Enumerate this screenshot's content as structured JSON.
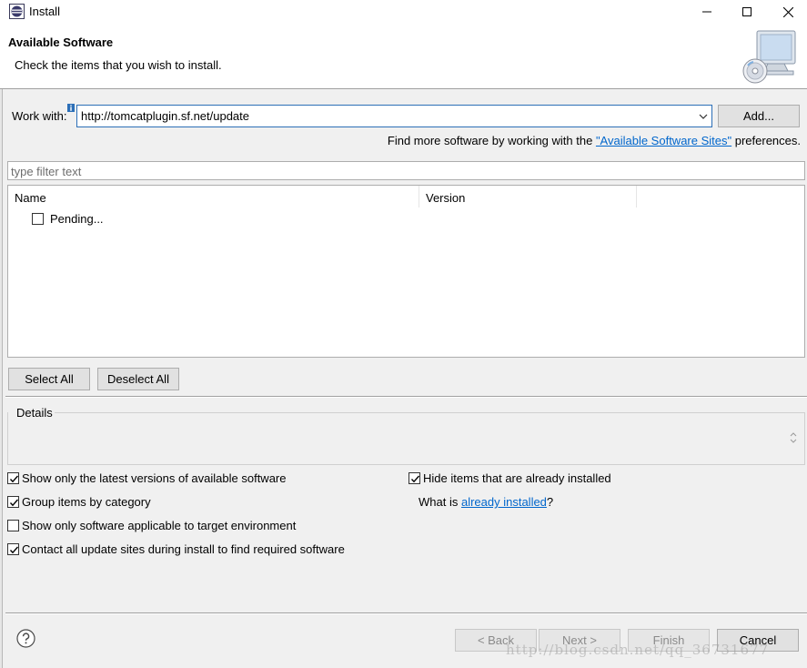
{
  "window": {
    "title": "Install",
    "minimize_icon": "minimize-icon",
    "maximize_icon": "maximize-icon",
    "close_icon": "close-icon"
  },
  "header": {
    "title": "Available Software",
    "description": "Check the items that you wish to install.",
    "image_icon": "monitor-cd-icon"
  },
  "work_with": {
    "label": "Work with:",
    "value": "http://tomcatplugin.sf.net/update",
    "add_label": "Add..."
  },
  "find_more": {
    "prefix": "Find more software by working with the ",
    "link": "\"Available Software Sites\"",
    "suffix": " preferences."
  },
  "filter": {
    "placeholder": "type filter text"
  },
  "tree": {
    "columns": [
      "Name",
      "Version"
    ],
    "rows": [
      {
        "label": "Pending...",
        "checked": false
      }
    ]
  },
  "selection_buttons": {
    "select_all": "Select All",
    "deselect_all": "Deselect All"
  },
  "details": {
    "label": "Details"
  },
  "options": {
    "latest_versions": {
      "label": "Show only the latest versions of available software",
      "checked": true
    },
    "group_by_category": {
      "label": "Group items by category",
      "checked": true
    },
    "applicable_only": {
      "label": "Show only software applicable to target environment",
      "checked": false
    },
    "contact_all_sites": {
      "label": "Contact all update sites during install to find required software",
      "checked": true
    },
    "hide_installed": {
      "label": "Hide items that are already installed",
      "checked": true
    }
  },
  "what_is": {
    "prefix": "What is ",
    "link": "already installed",
    "suffix": "?"
  },
  "footer": {
    "back": "< Back",
    "next": "Next >",
    "finish": "Finish",
    "cancel": "Cancel",
    "help_icon": "help-icon"
  },
  "watermark": "http://blog.csdn.net/qq_36731677",
  "colors": {
    "link": "#0066cc",
    "focus_border": "#2c6fb7",
    "dialog_bg": "#f0f0f0"
  }
}
